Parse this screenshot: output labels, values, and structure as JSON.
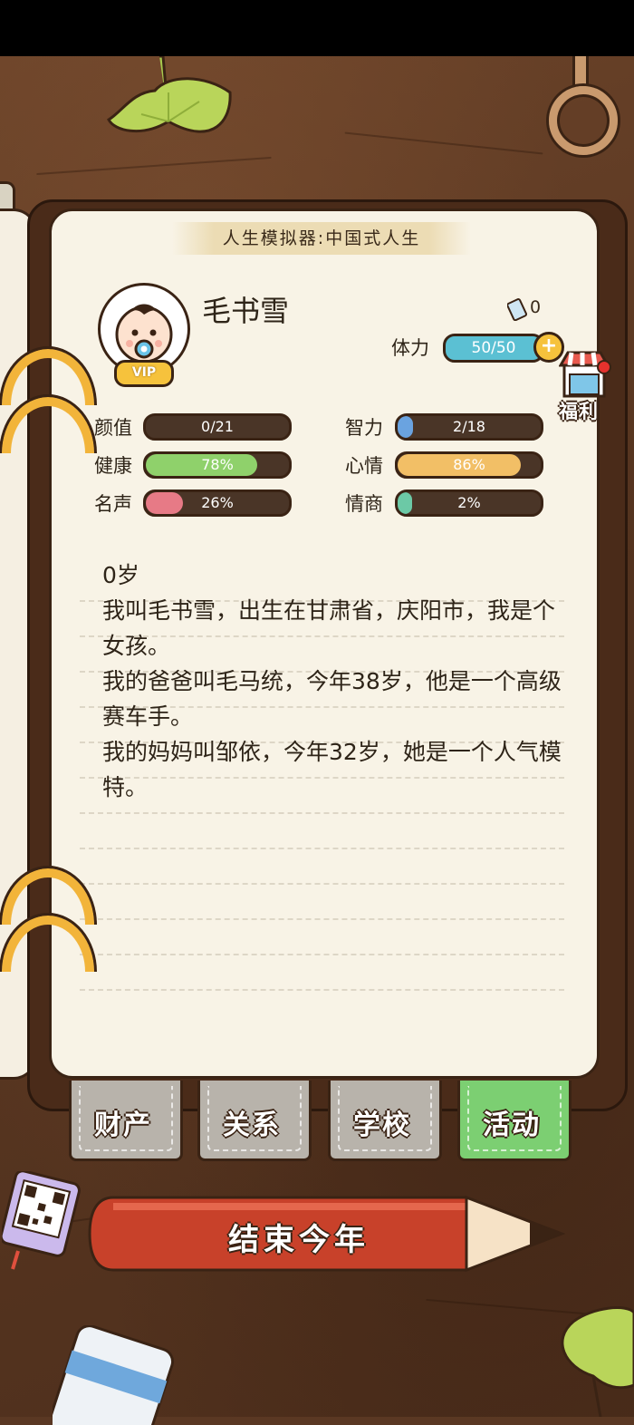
{
  "app_title": "人生模拟器:中国式人生",
  "character": {
    "name": "毛书雪",
    "badge": "VIP",
    "tickets": "0",
    "stamina_label": "体力",
    "stamina_value": "50/50",
    "stamina_fraction": 1.0,
    "welfare_label": "福利"
  },
  "stats": [
    {
      "label": "颜值",
      "text": "0/21",
      "fraction": 0.0,
      "color": "#e8a24a"
    },
    {
      "label": "智力",
      "text": "2/18",
      "fraction": 0.11,
      "color": "#6aa3e0"
    },
    {
      "label": "健康",
      "text": "78%",
      "fraction": 0.78,
      "color": "#8fd16b"
    },
    {
      "label": "心情",
      "text": "86%",
      "fraction": 0.86,
      "color": "#f2bf66"
    },
    {
      "label": "名声",
      "text": "26%",
      "fraction": 0.26,
      "color": "#e77a86"
    },
    {
      "label": "情商",
      "text": "2%",
      "fraction": 0.02,
      "color": "#6cc9a6"
    }
  ],
  "diary": [
    "0岁",
    "我叫毛书雪，出生在甘肃省，庆阳市，我是个女孩。",
    "我的爸爸叫毛马统，今年38岁，他是一个高级赛车手。",
    "我的妈妈叫邹依，今年32岁，她是一个人气模特。"
  ],
  "tabs": [
    {
      "label": "财产",
      "color": "#b8b3ab"
    },
    {
      "label": "关系",
      "color": "#b8b3ab"
    },
    {
      "label": "学校",
      "color": "#b8b3ab"
    },
    {
      "label": "活动",
      "color": "#7ccf72"
    }
  ],
  "end_year_button": "结束今年"
}
